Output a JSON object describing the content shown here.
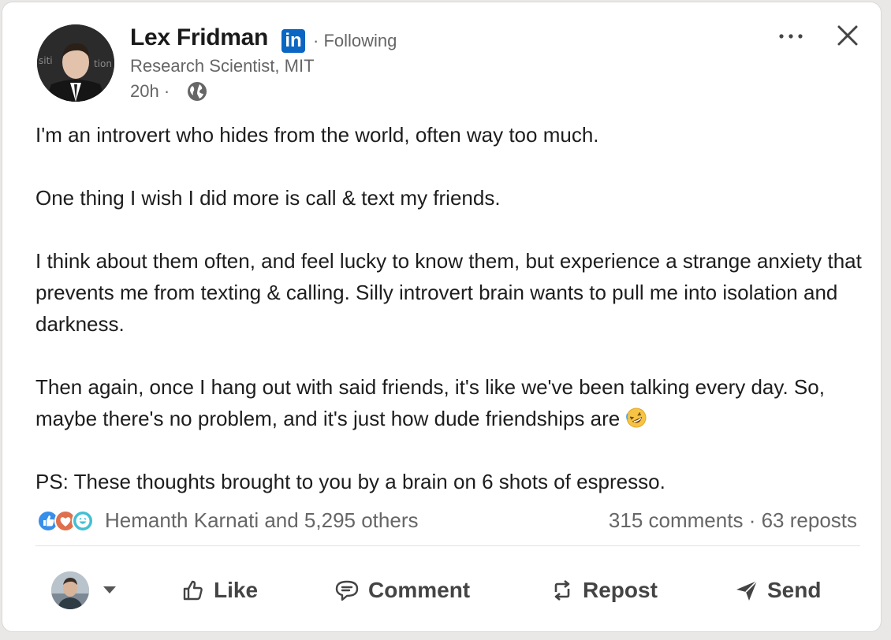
{
  "post": {
    "author": {
      "name": "Lex Fridman",
      "badge": "in",
      "follow_status": "· Following",
      "headline": "Research Scientist, MIT",
      "time": "20h ·",
      "visibility_icon": "globe-icon"
    },
    "menu_icon": "more-icon",
    "close_icon": "close-icon",
    "paragraphs": [
      "I'm an introvert who hides from the world, often way too much.",
      "One thing I wish I did more is call & text my friends.",
      "I think about them often, and feel lucky to know them, but experience a strange anxiety that prevents me from texting & calling. Silly introvert brain wants to pull me into isolation and darkness.",
      "Then again, once I hang out with said friends, it's like we've been talking every day. So, maybe there's no problem, and it's just how dude friendships are",
      "PS: These thoughts brought to you by a brain on 6 shots of espresso."
    ],
    "emoji": "rolling-on-floor-laughing-emoji"
  },
  "social": {
    "reaction_icons": [
      "like-reaction-icon",
      "love-reaction-icon",
      "funny-reaction-icon"
    ],
    "reactors_text": "Hemanth Karnati and 5,295 others",
    "comments": "315 comments",
    "separator": "·",
    "reposts": "63 reposts"
  },
  "actions": {
    "like": "Like",
    "comment": "Comment",
    "repost": "Repost",
    "send": "Send"
  },
  "colors": {
    "linkedin_blue": "#0a66c2",
    "secondary_text": "#666666",
    "action_text": "#444444"
  }
}
